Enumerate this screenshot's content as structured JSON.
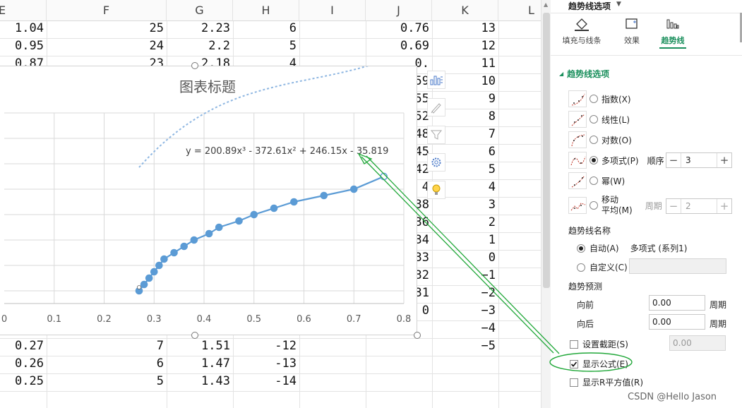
{
  "columns": [
    {
      "label": "E"
    },
    {
      "label": "F"
    },
    {
      "label": "G"
    },
    {
      "label": "H"
    },
    {
      "label": "I"
    },
    {
      "label": "J"
    },
    {
      "label": "K"
    },
    {
      "label": "L"
    }
  ],
  "rows_top": [
    {
      "e": "1.04",
      "f": "25",
      "g": "2.23",
      "h": "6",
      "j": "0.76",
      "k": "13"
    },
    {
      "e": "0.95",
      "f": "24",
      "g": "2.2",
      "h": "5",
      "j": "0.69",
      "k": "12"
    }
  ],
  "partial_row": {
    "e": "0.87",
    "f": "23",
    "g": "2.18",
    "h": "4",
    "j": "0.",
    "k": "11"
  },
  "j_partial": [
    "59",
    "55",
    "52",
    "48",
    "45",
    "42",
    "4",
    "38",
    "36",
    "34",
    "33",
    "32",
    "31",
    "0"
  ],
  "k_values": [
    "10",
    "9",
    "8",
    "7",
    "6",
    "5",
    "4",
    "3",
    "2",
    "1",
    "0",
    "−1",
    "−2",
    "−3",
    "−4",
    "−5"
  ],
  "rows_bottom": [
    {
      "e": "0.27",
      "f": "7",
      "g": "1.51",
      "h": "-12"
    },
    {
      "e": "0.26",
      "f": "6",
      "g": "1.47",
      "h": "-13"
    },
    {
      "e": "0.25",
      "f": "5",
      "g": "1.43",
      "h": "-14"
    }
  ],
  "chart_data": {
    "type": "scatter",
    "title": "图表标题",
    "equation": "y = 200.89x³ - 372.61x² + 246.15x - 35.819",
    "x_ticks": [
      "0",
      "0.1",
      "0.2",
      "0.3",
      "0.4",
      "0.5",
      "0.6",
      "0.7",
      "0.8"
    ],
    "xlim": [
      0,
      0.8
    ],
    "ylim": [
      -14,
      16
    ],
    "grid": true,
    "trendline": {
      "type": "polynomial",
      "order": 3,
      "coefficients": [
        200.89,
        -372.61,
        246.15,
        -35.819
      ]
    },
    "series": [
      {
        "x": [
          0.27,
          0.28,
          0.29,
          0.3,
          0.31,
          0.32,
          0.34,
          0.36,
          0.38,
          0.41,
          0.43,
          0.47,
          0.5,
          0.54,
          0.58,
          0.64,
          0.7,
          0.76
        ],
        "y": [
          -12,
          -11,
          -10,
          -9,
          -8,
          -7,
          -6,
          -5,
          -4,
          -3,
          -2,
          -1,
          0,
          1,
          2,
          3,
          4,
          6
        ]
      }
    ],
    "colors": {
      "series": "#5b9bd5",
      "gridline": "#d9d9d9",
      "annotation": "#22a83a"
    }
  },
  "side_buttons": [
    {
      "icon": "chart-elements-icon"
    },
    {
      "icon": "chart-style-brush-icon"
    },
    {
      "icon": "chart-filter-icon"
    },
    {
      "icon": "gear-icon"
    },
    {
      "icon": "lightbulb-icon"
    }
  ],
  "panel": {
    "header": "趋势线选项",
    "tabs": [
      {
        "label": "填充与线条",
        "icon": "fill-line-icon"
      },
      {
        "label": "效果",
        "icon": "effects-icon"
      },
      {
        "label": "趋势线",
        "icon": "trendline-tab-icon",
        "active": true
      }
    ],
    "section_title": "趋势线选项",
    "types": [
      {
        "label": "指数(X)",
        "icon": "exponential-trend-icon"
      },
      {
        "label": "线性(L)",
        "icon": "linear-trend-icon"
      },
      {
        "label": "对数(O)",
        "icon": "logarithmic-trend-icon"
      },
      {
        "label": "多项式(P)",
        "icon": "polynomial-trend-icon",
        "selected": true
      },
      {
        "label": "幂(W)",
        "icon": "power-trend-icon"
      },
      {
        "label": "移动",
        "label2": "平均(M)",
        "icon": "moving-average-icon"
      }
    ],
    "order_label": "顺序",
    "order_value": "3",
    "period_label": "周期",
    "period_value": "2",
    "name_title": "趋势线名称",
    "auto_label": "自动(A)",
    "auto_value": "多项式 (系列1)",
    "custom_label": "自定义(C)",
    "forecast_title": "趋势预测",
    "forward_label": "向前",
    "forward_value": "0.00",
    "backward_label": "向后",
    "backward_value": "0.00",
    "period_unit": "周期",
    "intercept_label": "设置截距(S)",
    "intercept_value": "0.00",
    "show_equation_label": "显示公式(E)",
    "show_equation_checked": true,
    "show_r2_label": "显示R平方值(R)"
  },
  "watermark": "CSDN @Hello Jason"
}
